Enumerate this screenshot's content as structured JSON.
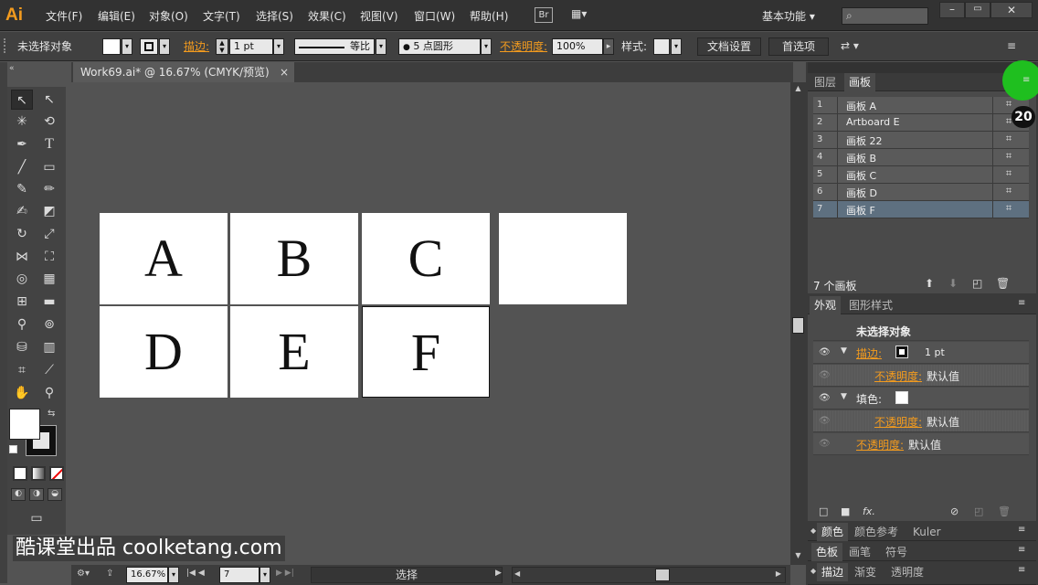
{
  "app": {
    "logo": "Ai"
  },
  "menu": [
    "文件(F)",
    "编辑(E)",
    "对象(O)",
    "文字(T)",
    "选择(S)",
    "效果(C)",
    "视图(V)",
    "窗口(W)",
    "帮助(H)"
  ],
  "menubar": {
    "bridge": "Br",
    "workspace": "基本功能",
    "search_placeholder": ""
  },
  "control": {
    "selection": "未选择对象",
    "stroke_label": "描边:",
    "stroke_weight": "1 pt",
    "profile": "等比",
    "brush": "5 点圆形",
    "opacity_label": "不透明度:",
    "opacity_value": "100%",
    "style_label": "样式:",
    "doc_setup": "文档设置",
    "prefs": "首选项"
  },
  "document": {
    "tab_title": "Work69.ai* @ 16.67% (CMYK/预览)",
    "close": "×"
  },
  "artboards_canvas": [
    {
      "letter": "A"
    },
    {
      "letter": "B"
    },
    {
      "letter": "C"
    },
    {
      "letter": ""
    },
    {
      "letter": "D"
    },
    {
      "letter": "E"
    },
    {
      "letter": "F"
    }
  ],
  "layers_panel": {
    "tabs": [
      "图层",
      "画板"
    ],
    "rows": [
      {
        "num": "1",
        "name": "画板 A"
      },
      {
        "num": "2",
        "name": "Artboard E"
      },
      {
        "num": "3",
        "name": "画板 22"
      },
      {
        "num": "4",
        "name": "画板 B"
      },
      {
        "num": "5",
        "name": "画板 C"
      },
      {
        "num": "6",
        "name": "画板 D"
      },
      {
        "num": "7",
        "name": "画板 F"
      }
    ],
    "count": "7 个画板",
    "badge": "20"
  },
  "appearance_panel": {
    "tabs": [
      "外观",
      "图形样式"
    ],
    "title": "未选择对象",
    "stroke_label": "描边:",
    "stroke_value": "1 pt",
    "opacity_label": "不透明度:",
    "default_value": "默认值",
    "fill_label": "填色:"
  },
  "collapsed_panels": [
    [
      "颜色",
      "颜色参考",
      "Kuler"
    ],
    [
      "色板",
      "画笔",
      "符号"
    ],
    [
      "描边",
      "渐变",
      "透明度"
    ]
  ],
  "status": {
    "zoom": "16.67%",
    "artboard": "7",
    "tool": "选择"
  },
  "watermark": "酷课堂出品 coolketang.com",
  "colors": {
    "accent_orange": "#f39b1e",
    "badge_green": "#1fbf1f",
    "selected_row": "#5e7080"
  }
}
